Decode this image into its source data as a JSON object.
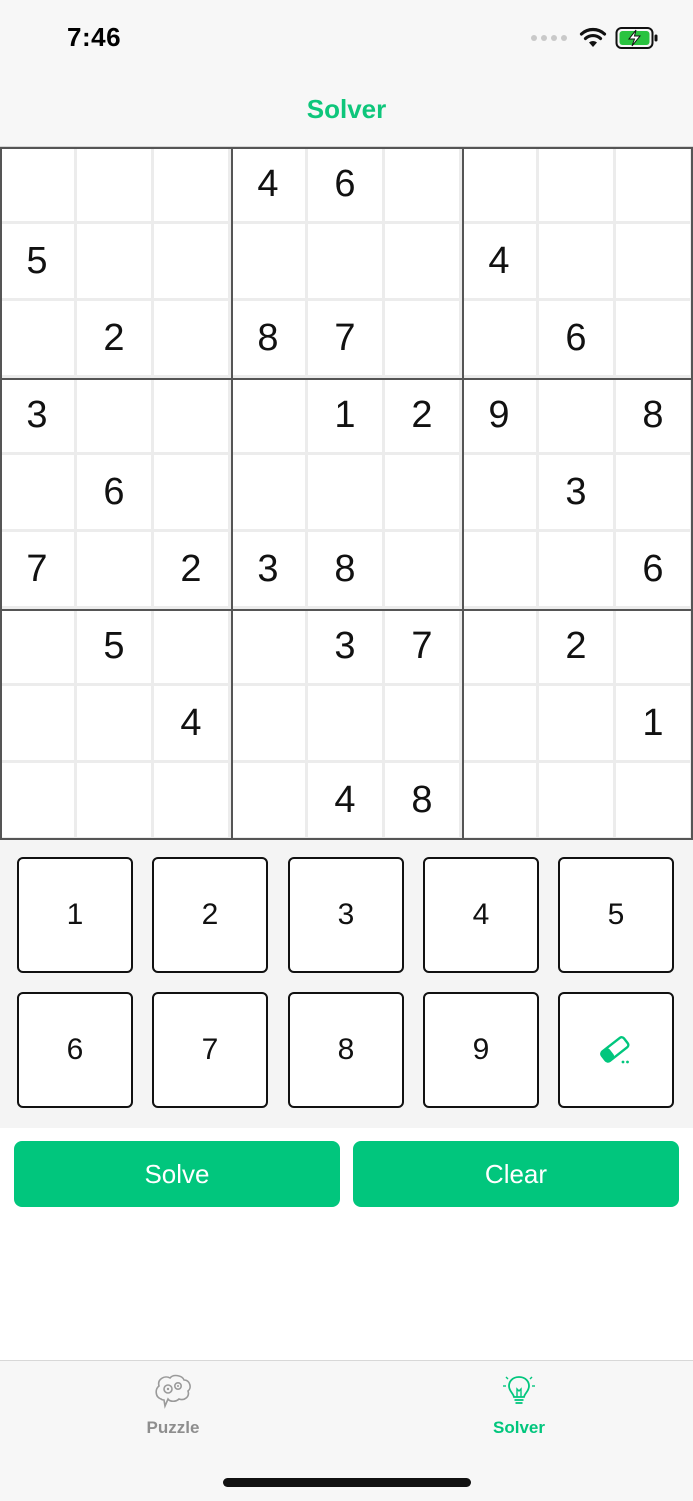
{
  "status_bar": {
    "time": "7:46"
  },
  "nav": {
    "title": "Solver"
  },
  "grid": [
    [
      "",
      "",
      "",
      "4",
      "6",
      "",
      "",
      "",
      ""
    ],
    [
      "5",
      "",
      "",
      "",
      "",
      "",
      "4",
      "",
      ""
    ],
    [
      "",
      "2",
      "",
      "8",
      "7",
      "",
      "",
      "6",
      ""
    ],
    [
      "3",
      "",
      "",
      "",
      "1",
      "2",
      "9",
      "",
      "8"
    ],
    [
      "",
      "6",
      "",
      "",
      "",
      "",
      "",
      "3",
      ""
    ],
    [
      "7",
      "",
      "2",
      "3",
      "8",
      "",
      "",
      "",
      "6"
    ],
    [
      "",
      "5",
      "",
      "",
      "3",
      "7",
      "",
      "2",
      ""
    ],
    [
      "",
      "",
      "4",
      "",
      "",
      "",
      "",
      "",
      "1"
    ],
    [
      "",
      "",
      "",
      "",
      "4",
      "8",
      "",
      "",
      ""
    ]
  ],
  "keypad": {
    "keys": [
      "1",
      "2",
      "3",
      "4",
      "5",
      "6",
      "7",
      "8",
      "9"
    ],
    "erase_icon": "eraser-icon"
  },
  "actions": {
    "solve_label": "Solve",
    "clear_label": "Clear"
  },
  "tabs": [
    {
      "label": "Puzzle",
      "icon": "brain-gears-icon",
      "active": false
    },
    {
      "label": "Solver",
      "icon": "lightbulb-icon",
      "active": true
    }
  ],
  "colors": {
    "accent": "#01c67d",
    "inactive": "#8e8e8e"
  }
}
